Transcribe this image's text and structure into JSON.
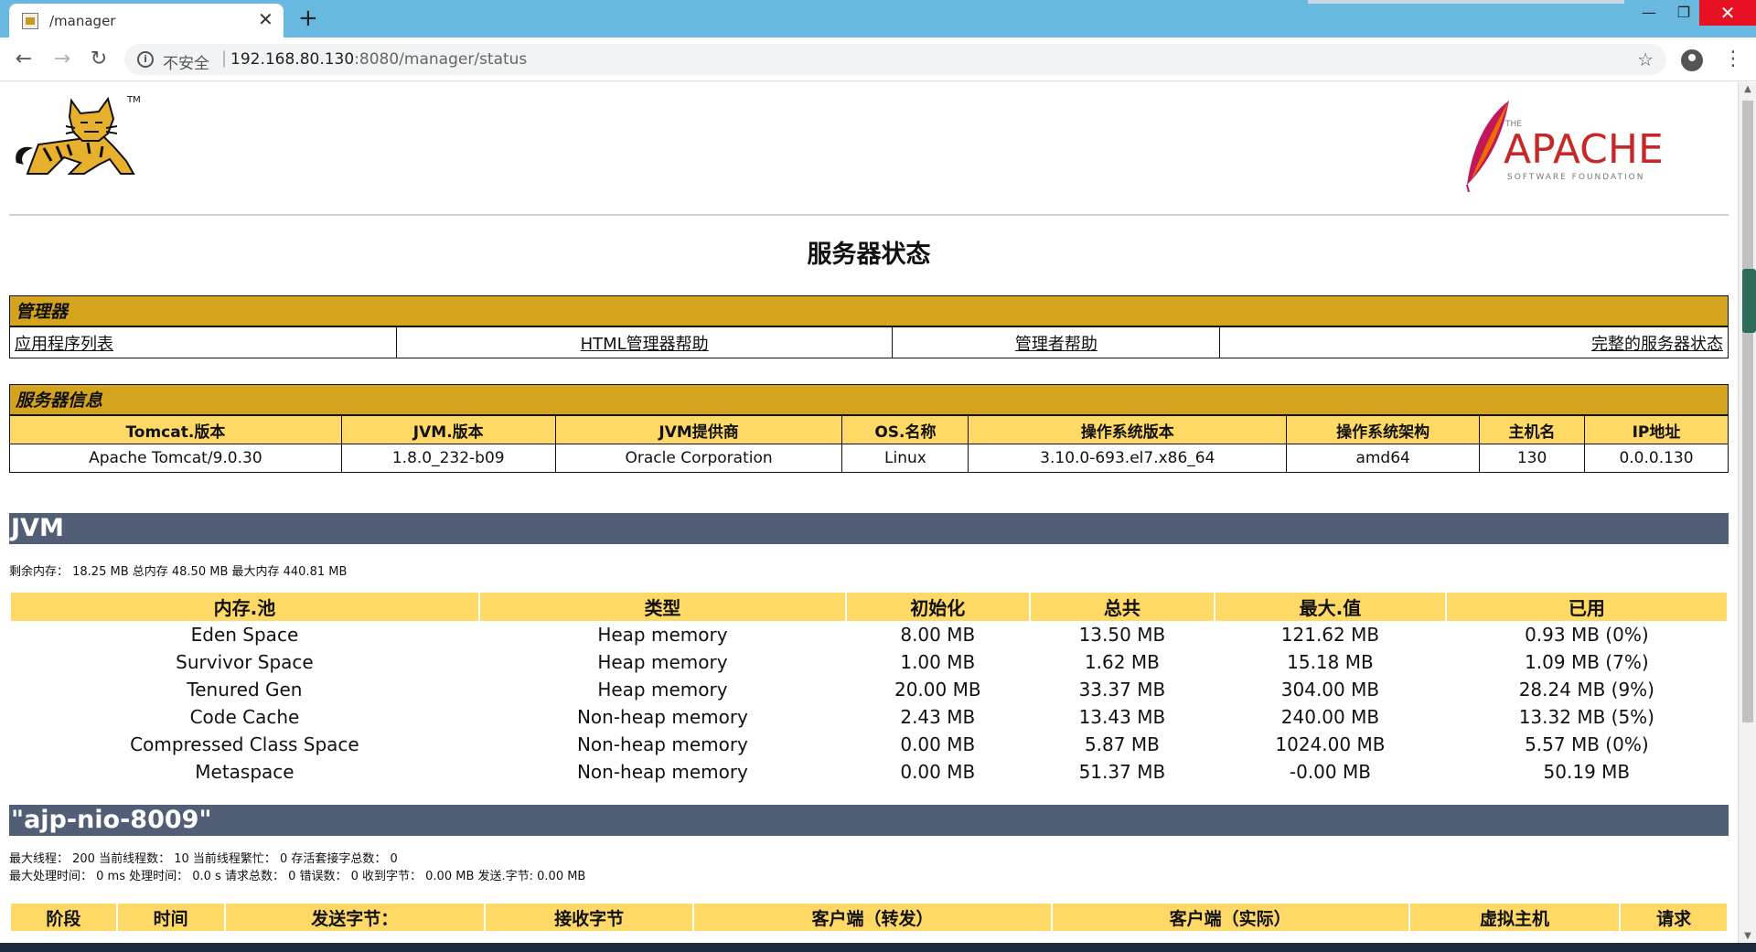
{
  "browser": {
    "tab_title": "/manager",
    "address": {
      "security": "不安全",
      "host": "192.168.80.130",
      "path": ":8080/manager/status"
    },
    "colors": {
      "titlebar": "#69b8e0",
      "close": "#e81123"
    }
  },
  "logos": {
    "tomcat_tm": "TM",
    "apache_the": "THE",
    "apache_word": "APACHE",
    "apache_sub": "SOFTWARE FOUNDATION"
  },
  "page_title": "服务器状态",
  "manager": {
    "header": "管理器",
    "links": [
      "应用程序列表",
      "HTML管理器帮助",
      "管理者帮助",
      "完整的服务器状态"
    ]
  },
  "server_info": {
    "header": "服务器信息",
    "columns": [
      "Tomcat.版本",
      "JVM.版本",
      "JVM提供商",
      "OS.名称",
      "操作系统版本",
      "操作系统架构",
      "主机名",
      "IP地址"
    ],
    "values": [
      "Apache Tomcat/9.0.30",
      "1.8.0_232-b09",
      "Oracle Corporation",
      "Linux",
      "3.10.0-693.el7.x86_64",
      "amd64",
      "130",
      "0.0.0.130"
    ]
  },
  "jvm": {
    "title": "JVM",
    "memory_summary": "剩余内存： 18.25 MB 总内存 48.50 MB 最大内存 440.81 MB",
    "columns": [
      "内存.池",
      "类型",
      "初始化",
      "总共",
      "最大.值",
      "已用"
    ],
    "rows": [
      [
        "Eden Space",
        "Heap memory",
        "8.00 MB",
        "13.50 MB",
        "121.62 MB",
        "0.93 MB (0%)"
      ],
      [
        "Survivor Space",
        "Heap memory",
        "1.00 MB",
        "1.62 MB",
        "15.18 MB",
        "1.09 MB (7%)"
      ],
      [
        "Tenured Gen",
        "Heap memory",
        "20.00 MB",
        "33.37 MB",
        "304.00 MB",
        "28.24 MB (9%)"
      ],
      [
        "Code Cache",
        "Non-heap memory",
        "2.43 MB",
        "13.43 MB",
        "240.00 MB",
        "13.32 MB (5%)"
      ],
      [
        "Compressed Class Space",
        "Non-heap memory",
        "0.00 MB",
        "5.87 MB",
        "1024.00 MB",
        "5.57 MB (0%)"
      ],
      [
        "Metaspace",
        "Non-heap memory",
        "0.00 MB",
        "51.37 MB",
        "-0.00 MB",
        "50.19 MB"
      ]
    ]
  },
  "connector": {
    "title": "\"ajp-nio-8009\"",
    "line1": "最大线程： 200 当前线程数： 10 当前线程繁忙： 0 存活套接字总数： 0",
    "line2": "最大处理时间： 0 ms 处理时间： 0.0 s 请求总数： 0 错误数： 0 收到字节： 0.00 MB 发送.字节: 0.00 MB",
    "columns": [
      "阶段",
      "时间",
      "发送字节：",
      "接收字节",
      "客户端（转发）",
      "客户端（实际）",
      "虚拟主机",
      "请求"
    ]
  },
  "colors": {
    "section_gold": "#d4a41e",
    "header_yellow": "#ffd966",
    "band_slate": "#525d76"
  }
}
